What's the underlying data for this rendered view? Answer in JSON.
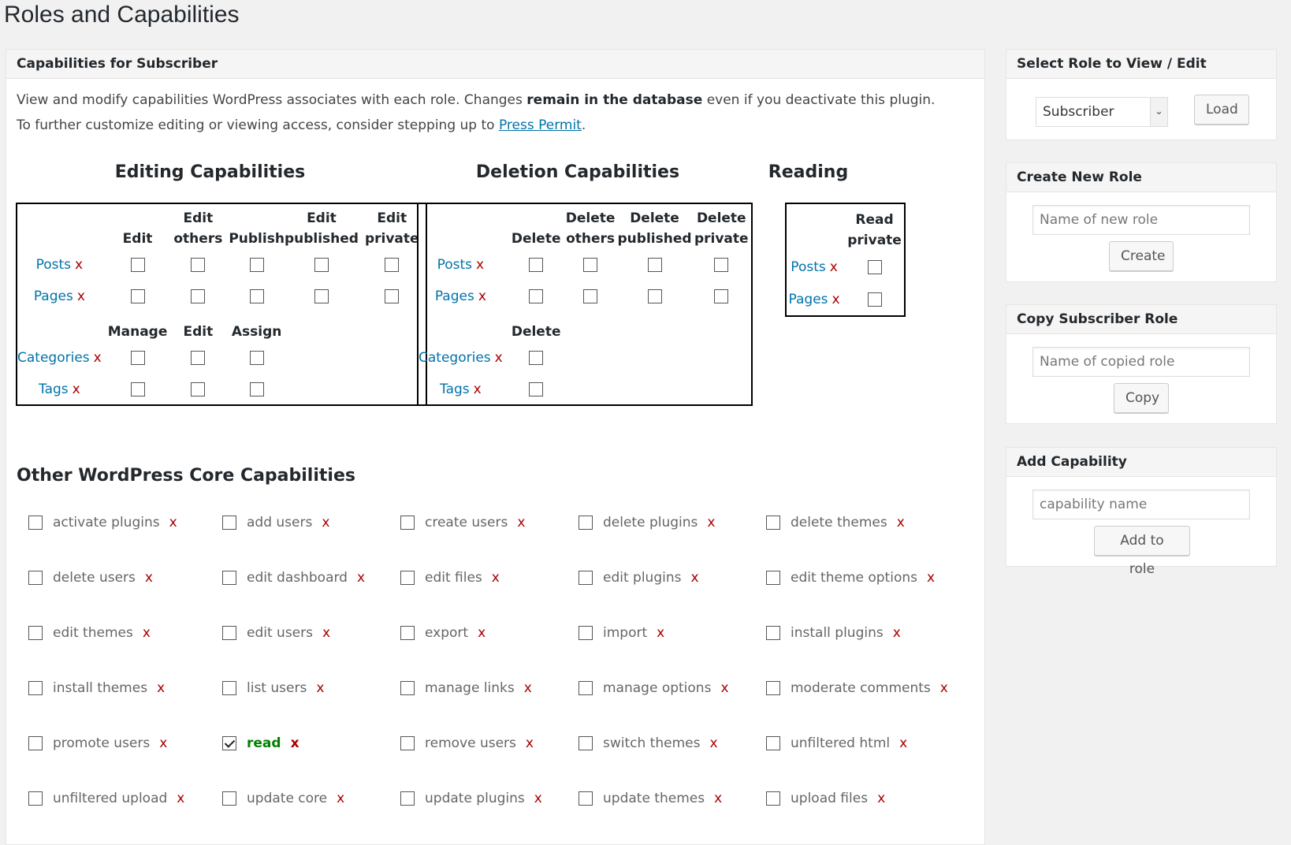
{
  "page_title": "Roles and Capabilities",
  "main": {
    "header": "Capabilities for Subscriber",
    "intro_line1_pre": "View and modify capabilities WordPress associates with each role. Changes ",
    "intro_line1_bold": "remain in the database",
    "intro_line1_post": " even if you deactivate this plugin.",
    "intro_line2_pre": "To further customize editing or viewing access, consider stepping up to ",
    "intro_line2_link": "Press Permit",
    "intro_line2_post": "."
  },
  "editing": {
    "title": "Editing Capabilities",
    "headers": [
      "Edit",
      "Edit others",
      "Publish",
      "Edit published",
      "Edit private"
    ],
    "rows": [
      "Posts",
      "Pages"
    ],
    "tax_headers": [
      "Manage",
      "Edit",
      "Assign"
    ],
    "tax_rows": [
      "Categories",
      "Tags"
    ]
  },
  "deletion": {
    "title": "Deletion Capabilities",
    "headers": [
      "Delete",
      "Delete others",
      "Delete published",
      "Delete private"
    ],
    "rows": [
      "Posts",
      "Pages"
    ],
    "tax_headers": [
      "Delete"
    ],
    "tax_rows": [
      "Categories",
      "Tags"
    ]
  },
  "reading": {
    "title": "Reading",
    "headers": [
      "Read private"
    ],
    "rows": [
      "Posts",
      "Pages"
    ]
  },
  "remove_mark": "x",
  "other": {
    "title": "Other WordPress Core Capabilities",
    "items": [
      {
        "label": "activate plugins",
        "checked": false
      },
      {
        "label": "add users",
        "checked": false
      },
      {
        "label": "create users",
        "checked": false
      },
      {
        "label": "delete plugins",
        "checked": false
      },
      {
        "label": "delete themes",
        "checked": false
      },
      {
        "label": "delete users",
        "checked": false
      },
      {
        "label": "edit dashboard",
        "checked": false
      },
      {
        "label": "edit files",
        "checked": false
      },
      {
        "label": "edit plugins",
        "checked": false
      },
      {
        "label": "edit theme options",
        "checked": false
      },
      {
        "label": "edit themes",
        "checked": false
      },
      {
        "label": "edit users",
        "checked": false
      },
      {
        "label": "export",
        "checked": false
      },
      {
        "label": "import",
        "checked": false
      },
      {
        "label": "install plugins",
        "checked": false
      },
      {
        "label": "install themes",
        "checked": false
      },
      {
        "label": "list users",
        "checked": false
      },
      {
        "label": "manage links",
        "checked": false
      },
      {
        "label": "manage options",
        "checked": false
      },
      {
        "label": "moderate comments",
        "checked": false
      },
      {
        "label": "promote users",
        "checked": false
      },
      {
        "label": "read",
        "checked": true
      },
      {
        "label": "remove users",
        "checked": false
      },
      {
        "label": "switch themes",
        "checked": false
      },
      {
        "label": "unfiltered html",
        "checked": false
      },
      {
        "label": "unfiltered upload",
        "checked": false
      },
      {
        "label": "update core",
        "checked": false
      },
      {
        "label": "update plugins",
        "checked": false
      },
      {
        "label": "update themes",
        "checked": false
      },
      {
        "label": "upload files",
        "checked": false
      }
    ]
  },
  "sidebar": {
    "select_role": {
      "header": "Select Role to View / Edit",
      "selected": "Subscriber",
      "button": "Load"
    },
    "create_role": {
      "header": "Create New Role",
      "placeholder": "Name of new role",
      "button": "Create"
    },
    "copy_role": {
      "header": "Copy Subscriber Role",
      "placeholder": "Name of copied role",
      "button": "Copy"
    },
    "add_cap": {
      "header": "Add Capability",
      "placeholder": "capability name",
      "button": "Add to role"
    }
  },
  "colors": {
    "link": "#0073aa",
    "remove": "#aa0000",
    "checked_text": "#008000"
  }
}
